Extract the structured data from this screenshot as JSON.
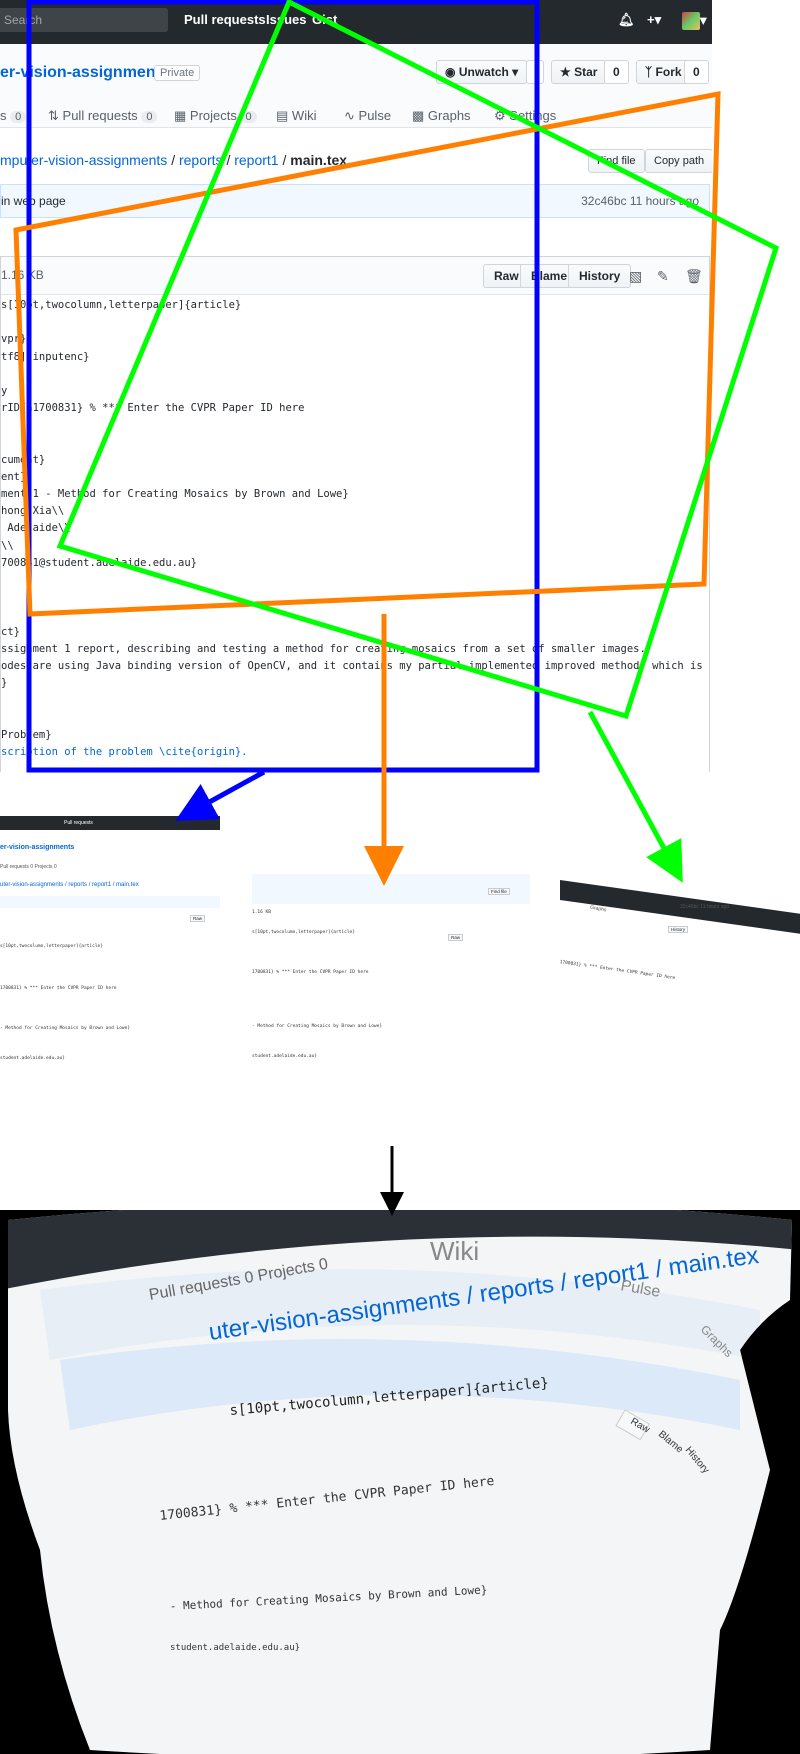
{
  "header": {
    "search_placeholder": "Search",
    "nav": [
      "Pull requests",
      "Issues",
      "Gist"
    ],
    "icons": [
      "bell-icon",
      "plus-icon",
      "avatar"
    ]
  },
  "repo": {
    "name": "er-vision-assignments",
    "visibility": "Private",
    "unwatch": "Unwatch",
    "watch_count": "",
    "star": "Star",
    "star_count": "0",
    "fork": "Fork",
    "fork_count": "0",
    "tabs": [
      {
        "label": "s",
        "count": "0"
      },
      {
        "label": "Pull requests",
        "count": "0"
      },
      {
        "label": "Projects",
        "count": "0"
      },
      {
        "label": "Wiki",
        "count": ""
      },
      {
        "label": "Pulse",
        "count": ""
      },
      {
        "label": "Graphs",
        "count": ""
      },
      {
        "label": "Settings",
        "count": ""
      }
    ]
  },
  "breadcrumb": {
    "repo": "mputer-vision-assignments",
    "sep": "/",
    "reports": "reports",
    "report1": "report1",
    "file": "main.tex",
    "find_file": "Find file",
    "copy_path": "Copy path"
  },
  "commit": {
    "message": "in web page",
    "sha_time": "32c46bc 11 hours ago"
  },
  "file": {
    "size": "1.16 KB",
    "raw": "Raw",
    "blame": "Blame",
    "history": "History",
    "lines": [
      "s[10pt,twocolumn,letterpaper]{article}",
      "",
      "vpr}",
      "tf8]{inputenc}",
      "",
      "y",
      "rID{a1700831} % *** Enter the CVPR Paper ID here",
      "",
      "",
      "cument}",
      "ent}",
      "ment 1 - Method for Creating Mosaics by Brown and Lowe}",
      "hong Xia\\\\",
      " Adelaide\\\\",
      "\\\\",
      "700831@student.adelaide.edu.au}",
      "",
      "",
      "",
      "ct}",
      "ssignment 1 report, describing and testing a method for creating mosaics from a set of smaller images.",
      "odes are using Java binding version of OpenCV, and it contains my partial implemented improved method, which is used to test my",
      "}",
      "",
      "",
      "Problem}",
      "scription of the problem \\cite{origin}."
    ]
  },
  "output": {
    "crumb": "uter-vision-assignments / reports / report1 / main.tex",
    "tabs_text": "Pull requests  0    Projects  0",
    "wiki": "Wiki",
    "pulse": "Pulse",
    "graphs": "Graphs",
    "code_line_1": "s[10pt,twocolumn,letterpaper]{article}",
    "code_line_2": "1700831} % *** Enter the CVPR Paper ID here",
    "code_line_3": "- Method for Creating Mosaics by Brown and Lowe}",
    "code_line_4": "student.adelaide.edu.au}"
  },
  "colors": {
    "blue_frame": "#0000ff",
    "orange_frame": "#ff8000",
    "green_frame": "#00ff00",
    "github_dark": "#24292e",
    "link": "#0366d6"
  }
}
